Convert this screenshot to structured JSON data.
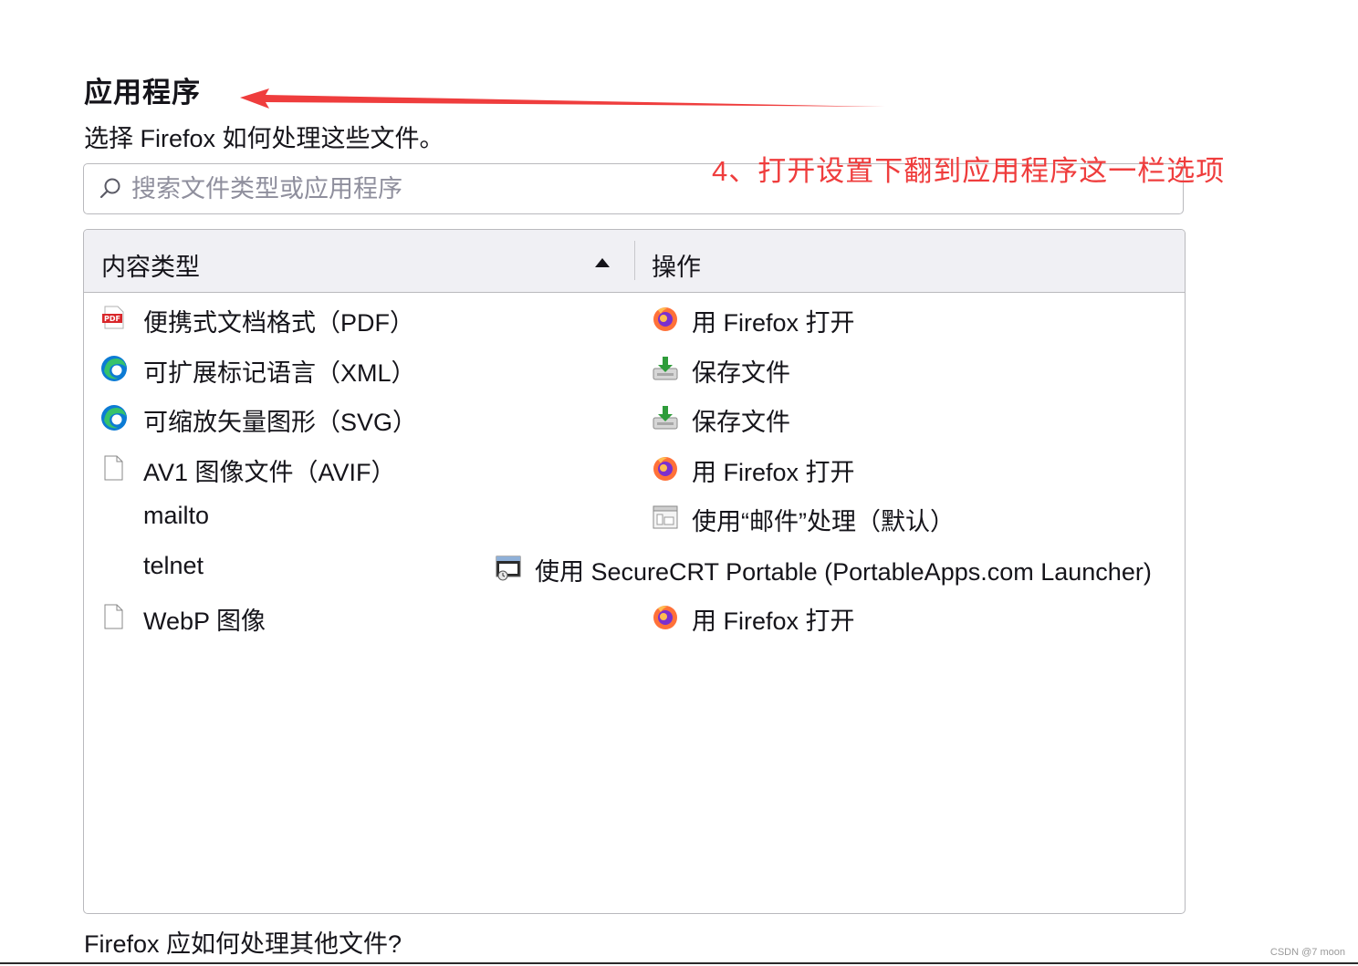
{
  "section": {
    "title": "应用程序",
    "description": "选择 Firefox 如何处理这些文件。"
  },
  "annotation": {
    "text": "4、打开设置下翻到应用程序这一栏选项",
    "color": "#ef3d3d"
  },
  "search": {
    "placeholder": "搜索文件类型或应用程序",
    "icon": "search-icon"
  },
  "table": {
    "header": {
      "content_type": "内容类型",
      "action": "操作",
      "sort": "ascending"
    },
    "rows": [
      {
        "type": "便携式文档格式（PDF）",
        "type_icon": "pdf-icon",
        "action": "用 Firefox 打开",
        "action_icon": "firefox-icon"
      },
      {
        "type": "可扩展标记语言（XML）",
        "type_icon": "edge-icon",
        "action": "保存文件",
        "action_icon": "save-download-icon"
      },
      {
        "type": "可缩放矢量图形（SVG）",
        "type_icon": "edge-icon",
        "action": "保存文件",
        "action_icon": "save-download-icon"
      },
      {
        "type": "AV1 图像文件（AVIF）",
        "type_icon": "file-icon",
        "action": "用 Firefox 打开",
        "action_icon": "firefox-icon"
      },
      {
        "type": "mailto",
        "type_icon": "",
        "action": "使用“邮件”处理（默认）",
        "action_icon": "app-window-icon"
      },
      {
        "type": "telnet",
        "type_icon": "",
        "action": "使用 SecureCRT Portable (PortableApps.com Launcher)",
        "action_icon": "securecrt-icon"
      },
      {
        "type": "WebP 图像",
        "type_icon": "file-icon",
        "action": "用 Firefox 打开",
        "action_icon": "firefox-icon"
      }
    ]
  },
  "footer": {
    "question": "Firefox 应如何处理其他文件?"
  },
  "watermark": "CSDN @7 moon"
}
